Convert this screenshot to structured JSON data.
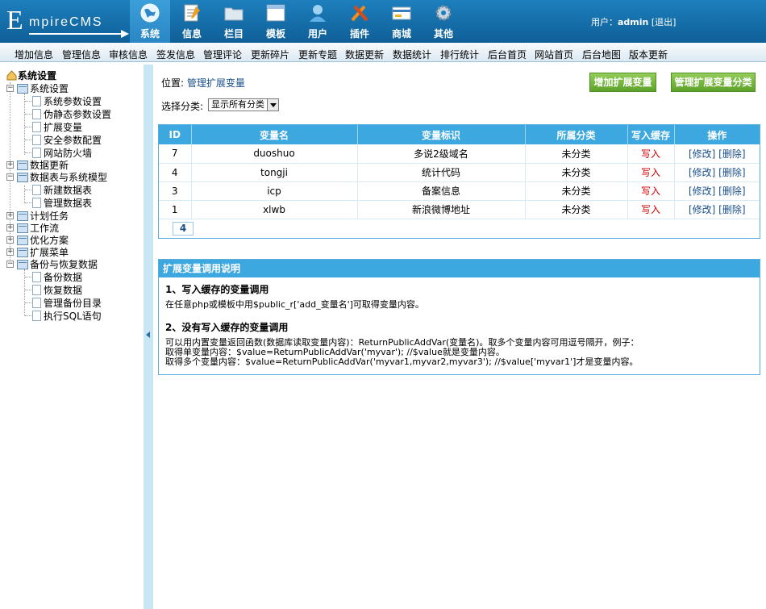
{
  "logo": {
    "big": "E",
    "rest": "mpireCMS"
  },
  "mainnav": [
    {
      "label": "系统",
      "icon": "globe-icon"
    },
    {
      "label": "信息",
      "icon": "notepad-icon"
    },
    {
      "label": "栏目",
      "icon": "folder-icon"
    },
    {
      "label": "模板",
      "icon": "window-icon"
    },
    {
      "label": "用户",
      "icon": "user-icon"
    },
    {
      "label": "插件",
      "icon": "tools-icon"
    },
    {
      "label": "商城",
      "icon": "card-icon"
    },
    {
      "label": "其他",
      "icon": "gear-icon"
    }
  ],
  "user": {
    "prefix": "用户：",
    "name": "admin",
    "logout": "[退出]"
  },
  "subnav": [
    "增加信息",
    "管理信息",
    "审核信息",
    "签发信息",
    "管理评论",
    "更新碎片",
    "更新专题",
    "数据更新",
    "数据统计",
    "排行统计",
    "后台首页",
    "网站首页",
    "后台地图",
    "版本更新"
  ],
  "tree": {
    "title": "系统设置",
    "groups": [
      {
        "label": "系统设置",
        "expanded": true,
        "children": [
          "系统参数设置",
          "伪静态参数设置",
          "扩展变量",
          "安全参数配置",
          "网站防火墙"
        ]
      },
      {
        "label": "数据更新",
        "expanded": false,
        "children": []
      },
      {
        "label": "数据表与系统模型",
        "expanded": true,
        "children": [
          "新建数据表",
          "管理数据表"
        ]
      },
      {
        "label": "计划任务",
        "expanded": false,
        "children": []
      },
      {
        "label": "工作流",
        "expanded": false,
        "children": []
      },
      {
        "label": "优化方案",
        "expanded": false,
        "children": []
      },
      {
        "label": "扩展菜单",
        "expanded": false,
        "children": []
      },
      {
        "label": "备份与恢复数据",
        "expanded": true,
        "children": [
          "备份数据",
          "恢复数据",
          "管理备份目录",
          "执行SQL语句"
        ]
      }
    ]
  },
  "main": {
    "location_prefix": "位置: ",
    "location_link": "管理扩展变量",
    "add_button": "增加扩展变量",
    "manage_class_button": "管理扩展变量分类",
    "select_label": "选择分类: ",
    "select_value": "显示所有分类",
    "table": {
      "headers": [
        "ID",
        "变量名",
        "变量标识",
        "所属分类",
        "写入缓存",
        "操作"
      ],
      "rows": [
        {
          "id": "7",
          "name": "duoshuo",
          "label": "多说2级域名",
          "category": "未分类",
          "cache": "写入",
          "edit": "[修改]",
          "del": "[删除]"
        },
        {
          "id": "4",
          "name": "tongji",
          "label": "统计代码",
          "category": "未分类",
          "cache": "写入",
          "edit": "[修改]",
          "del": "[删除]"
        },
        {
          "id": "3",
          "name": "icp",
          "label": "备案信息",
          "category": "未分类",
          "cache": "写入",
          "edit": "[修改]",
          "del": "[删除]"
        },
        {
          "id": "1",
          "name": "xlwb",
          "label": "新浪微博地址",
          "category": "未分类",
          "cache": "写入",
          "edit": "[修改]",
          "del": "[删除]"
        }
      ],
      "pager": "4"
    },
    "help": {
      "title": "扩展变量调用说明",
      "s1_title": "1、写入缓存的变量调用",
      "s1_text": "在任意php或模板中用$public_r['add_变量名']可取得变量内容。",
      "s2_title": "2、没有写入缓存的变量调用",
      "s2_line1": "可以用内置变量返回函数(数据库读取变量内容)：ReturnPublicAddVar(变量名)。取多个变量内容可用逗号隔开，例子：",
      "s2_line2": "取得单变量内容：$value=ReturnPublicAddVar('myvar'); //$value就是变量内容。",
      "s2_line3": "取得多个变量内容：$value=ReturnPublicAddVar('myvar1,myvar2,myvar3'); //$value['myvar1']才是变量内容。"
    }
  },
  "colors": {
    "header": "#1d7fbd",
    "tablehead": "#3da8e0",
    "button": "#6cad35",
    "red": "#d00000"
  }
}
